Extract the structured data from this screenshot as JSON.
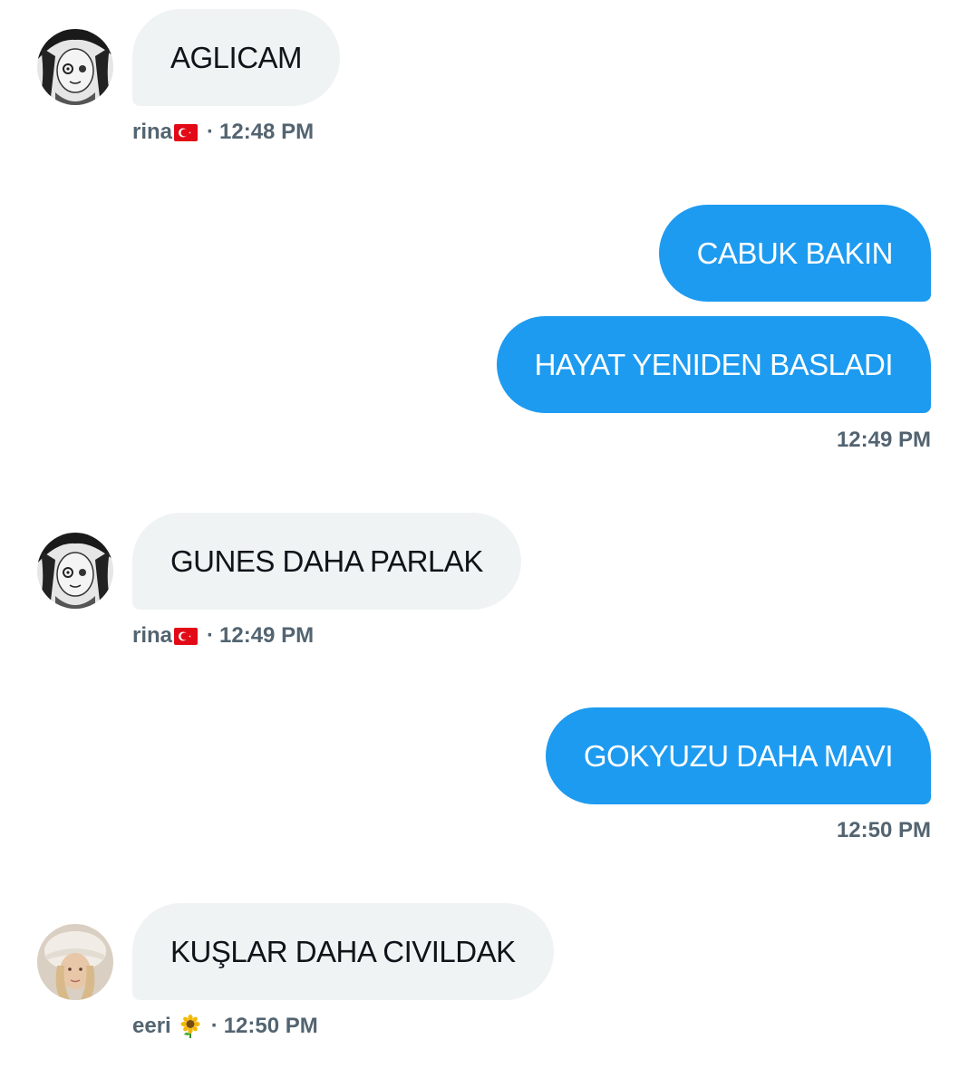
{
  "messages": [
    {
      "sender": "rina",
      "direction": "in",
      "text": "AGLICAM"
    },
    {
      "direction": "out",
      "text": "CABUK BAKIN"
    },
    {
      "direction": "out",
      "text": "HAYAT YENIDEN BASLADI"
    },
    {
      "sender": "rina",
      "direction": "in",
      "text": "GUNES DAHA PARLAK"
    },
    {
      "direction": "out",
      "text": "GOKYUZU DAHA MAVI"
    },
    {
      "sender": "eeri",
      "direction": "in",
      "text": "KUŞLAR DAHA CIVILDAK"
    }
  ],
  "meta": {
    "m1": {
      "name": "rina",
      "emoji": "turkey-flag-emoji",
      "separator": "·",
      "time": "12:48 PM"
    },
    "m2": {
      "time": "12:49 PM"
    },
    "m3": {
      "name": "rina",
      "emoji": "turkey-flag-emoji",
      "separator": "·",
      "time": "12:49 PM"
    },
    "m4": {
      "time": "12:50 PM"
    },
    "m5": {
      "name": "eeri",
      "emoji": "sunflower-emoji",
      "separator": "·",
      "time": "12:50 PM"
    }
  },
  "colors": {
    "incoming_bubble": "#eff3f4",
    "outgoing_bubble": "#1d9bf0",
    "meta_text": "#536471",
    "message_text": "#0f1419"
  }
}
